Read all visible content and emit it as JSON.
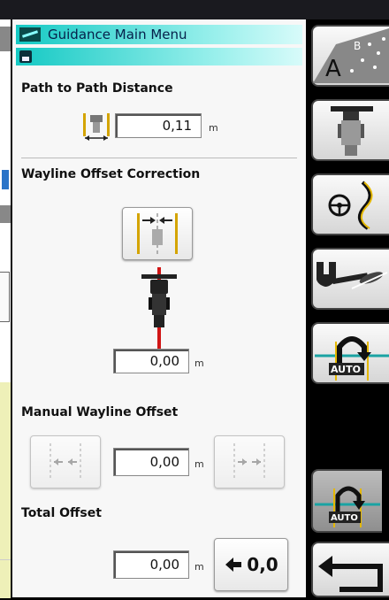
{
  "header": {
    "title": "Guidance Main Menu"
  },
  "path_distance": {
    "label": "Path to Path Distance",
    "value": "0,11",
    "unit": "m"
  },
  "wayline_offset": {
    "label": "Wayline Offset Correction",
    "value": "0,00",
    "unit": "m"
  },
  "manual_offset": {
    "label": "Manual Wayline Offset",
    "value": "0,00",
    "unit": "m"
  },
  "total_offset": {
    "label": "Total Offset",
    "value": "0,00",
    "unit": "m",
    "apply_button_label": "0,0"
  },
  "sidebar": {
    "items": [
      {
        "name": "ab-pattern",
        "text": "A",
        "sup": "B"
      },
      {
        "name": "implement-settings"
      },
      {
        "name": "steering"
      },
      {
        "name": "tools"
      },
      {
        "name": "auto-turn",
        "text": "AUTO"
      },
      {
        "name": "auto-turn-active",
        "text": "AUTO"
      }
    ]
  },
  "colors": {
    "title_bar": "#15c9c4",
    "accent_red": "#d01515",
    "accent_yellow": "#e5b800"
  }
}
